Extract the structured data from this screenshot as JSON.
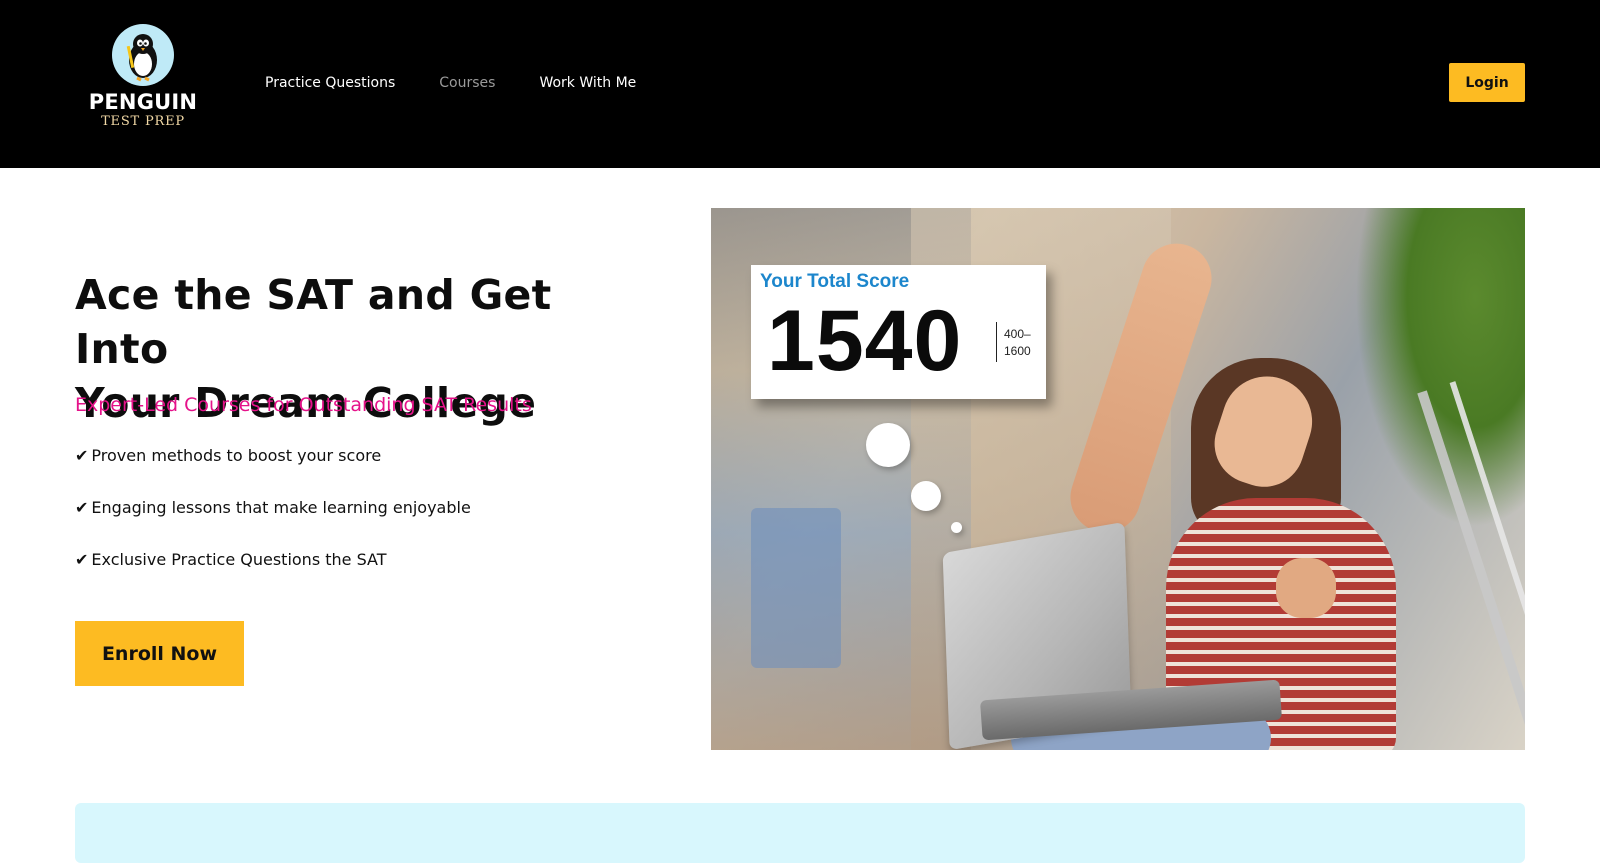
{
  "brand": {
    "name": "PENGUIN",
    "tagline": "TEST PREP",
    "logo_icon": "penguin-icon"
  },
  "nav": {
    "items": [
      {
        "label": "Practice Questions",
        "state": "normal"
      },
      {
        "label": "Courses",
        "state": "muted"
      },
      {
        "label": "Work With Me",
        "state": "normal"
      }
    ],
    "login_label": "Login"
  },
  "hero": {
    "title_line1": "Ace the SAT and Get Into",
    "title_line2": "Your Dream College",
    "subtitle": "Expert-Led Courses for Outstanding SAT Results",
    "features": [
      "Proven methods to boost your score",
      "Engaging lessons that make learning enjoyable",
      "Exclusive Practice Questions the SAT"
    ],
    "check_glyph": "✔",
    "cta_label": "Enroll Now"
  },
  "hero_image": {
    "score_label": "Your Total Score",
    "score_value": "1540",
    "range_low": "400–",
    "range_high": "1600"
  },
  "colors": {
    "header_bg": "#000000",
    "accent_yellow": "#fdbb22",
    "subtitle_pink": "#e5128a",
    "score_blue": "#1c86cc",
    "strip_cyan": "#d8f7fd"
  }
}
